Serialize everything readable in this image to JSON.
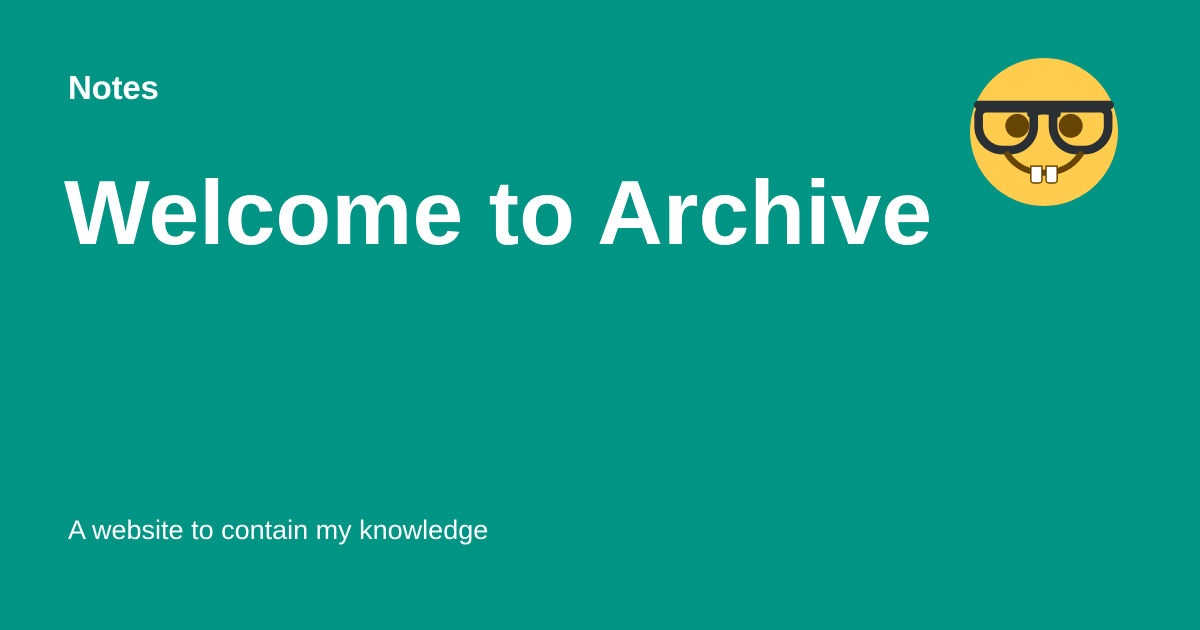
{
  "card": {
    "site_name": "Notes",
    "title": "Welcome to Archive",
    "description": "A website to contain my knowledge",
    "emoji_icon": "nerd-face-icon"
  },
  "colors": {
    "background": "#009485",
    "text": "#ffffff",
    "emoji_face": "#FFCC4D",
    "emoji_features": "#292F33",
    "emoji_eyes": "#664500"
  }
}
